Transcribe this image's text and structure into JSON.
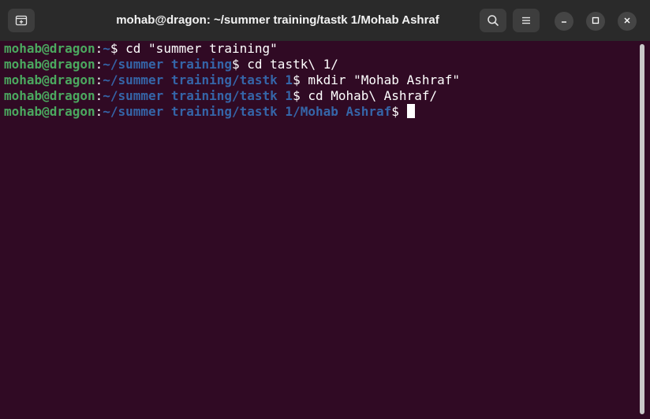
{
  "window": {
    "title": "mohab@dragon: ~/summer training/tastk 1/Mohab Ashraf"
  },
  "titlebar": {
    "new_tab_icon": "new-tab-icon",
    "search_icon": "search-icon",
    "menu_icon": "hamburger-menu-icon",
    "minimize_icon": "minimize-icon",
    "maximize_icon": "maximize-icon",
    "close_icon": "close-icon"
  },
  "colors": {
    "background": "#300a24",
    "user_host": "#4ba85f",
    "path": "#3565a8",
    "text": "#ffffff"
  },
  "terminal": {
    "lines": [
      {
        "user": "mohab@dragon",
        "sep": ":",
        "path": "~",
        "prompt": "$",
        "command": " cd \"summer training\""
      },
      {
        "user": "mohab@dragon",
        "sep": ":",
        "path": "~/summer training",
        "prompt": "$",
        "command": " cd tastk\\ 1/"
      },
      {
        "user": "mohab@dragon",
        "sep": ":",
        "path": "~/summer training/tastk 1",
        "prompt": "$",
        "command": " mkdir \"Mohab Ashraf\""
      },
      {
        "user": "mohab@dragon",
        "sep": ":",
        "path": "~/summer training/tastk 1",
        "prompt": "$",
        "command": " cd Mohab\\ Ashraf/"
      },
      {
        "user": "mohab@dragon",
        "sep": ":",
        "path": "~/summer training/tastk 1/Mohab Ashraf",
        "prompt": "$",
        "command": ""
      }
    ]
  }
}
